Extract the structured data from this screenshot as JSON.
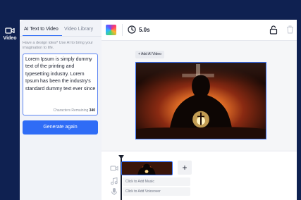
{
  "sidebar": {
    "items": [
      {
        "label": "Video",
        "icon": "video-camera-icon"
      }
    ]
  },
  "panel": {
    "tabs": [
      {
        "label": "AI Text to Video",
        "active": true
      },
      {
        "label": "Video Library",
        "active": false
      }
    ],
    "hint": "Have a design idea? Use AI to bring your imagination to life.",
    "prompt_value": "Lorem Ipsum is simply dummy text of the printing and typesetting industry. Lorem Ipsum has been the industry's standard dummy text ever since",
    "chars_label": "Characters Remaining",
    "chars_remaining": "340",
    "generate_label": "Generate again"
  },
  "toolbar": {
    "duration": "5.0s",
    "icons": [
      "color-palette-icon",
      "clock-icon",
      "lock-icon",
      "trash-icon"
    ]
  },
  "canvas": {
    "add_ai_video_label": "+ Add AI Video"
  },
  "timeline": {
    "add_music_label": "Click to Add Music",
    "add_voiceover_label": "Click to Add Voiceover",
    "add_clip_label": "+"
  },
  "colors": {
    "navy": "#0f2151",
    "accent": "#2f6cf6",
    "panel_bg": "#f1f3f8"
  }
}
